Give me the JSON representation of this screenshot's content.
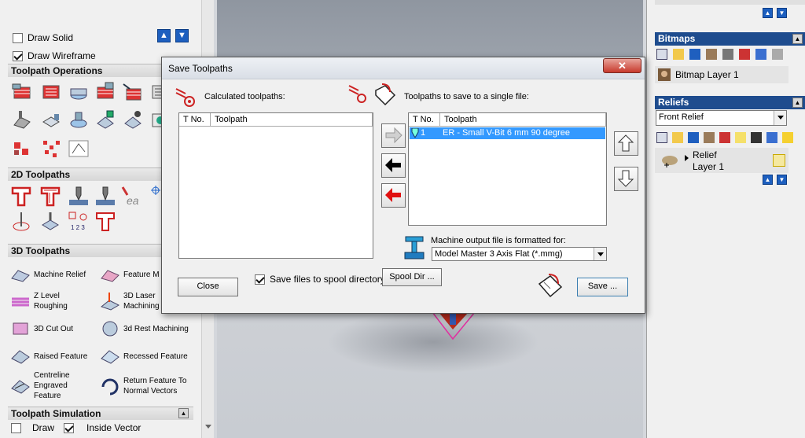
{
  "left_panel": {
    "draw_solid": {
      "label": "Draw Solid",
      "checked": false
    },
    "draw_wireframe": {
      "label": "Draw Wireframe",
      "checked": true
    },
    "sections": {
      "toolpath_operations": "Toolpath Operations",
      "toolpaths_2d": "2D Toolpaths",
      "toolpaths_3d": "3D Toolpaths",
      "toolpath_simulation": "Toolpath Simulation"
    },
    "tools_3d": [
      {
        "label": "Machine Relief",
        "icon": "machine-relief-icon"
      },
      {
        "label": "Feature M",
        "icon": "feature-machining-icon"
      },
      {
        "label": "Z Level\nRoughing",
        "icon": "z-level-roughing-icon"
      },
      {
        "label": "3D Laser\nMachining",
        "icon": "laser-machining-icon"
      },
      {
        "label": "3D Cut Out",
        "icon": "cut-out-icon"
      },
      {
        "label": "3d Rest Machining",
        "icon": "rest-machining-icon"
      },
      {
        "label": "Raised Feature",
        "icon": "raised-feature-icon"
      },
      {
        "label": "Recessed Feature",
        "icon": "recessed-feature-icon"
      },
      {
        "label": "Centreline\nEngraved\nFeature",
        "icon": "centreline-engraved-icon"
      },
      {
        "label": "Return Feature To\nNormal Vectors",
        "icon": "return-feature-icon"
      }
    ],
    "simulation": {
      "draw_label": "Draw",
      "inside_vector_label": "Inside Vector",
      "inside_vector_checked": true
    }
  },
  "right_panel": {
    "bitmaps": {
      "title": "Bitmaps",
      "layer": "Bitmap Layer 1"
    },
    "reliefs": {
      "title": "Reliefs",
      "selected": "Front Relief",
      "layer_line1": "Relief",
      "layer_line2": "Layer 1"
    }
  },
  "dialog": {
    "title": "Save Toolpaths",
    "close_glyph": "✕",
    "calculated_label": "Calculated toolpaths:",
    "save_label": "Toolpaths to save to a single file:",
    "columns": {
      "t_no": "T No.",
      "toolpath": "Toolpath"
    },
    "calculated_rows": [],
    "save_rows": [
      {
        "t_no": "1",
        "toolpath": "ER - Small V-Bit 6 mm 90 degree"
      }
    ],
    "machine_label": "Machine output file is formatted for:",
    "machine_format": "Model Master 3 Axis Flat (*.mmg)",
    "close_button": "Close",
    "spool_checkbox": {
      "label": "Save files to spool directory",
      "checked": true
    },
    "spool_dir_button": "Spool Dir ...",
    "save_button": "Save ..."
  },
  "colors": {
    "accent_blue": "#1e4c8e",
    "selection": "#3399ff",
    "close_red": "#c7392c"
  }
}
